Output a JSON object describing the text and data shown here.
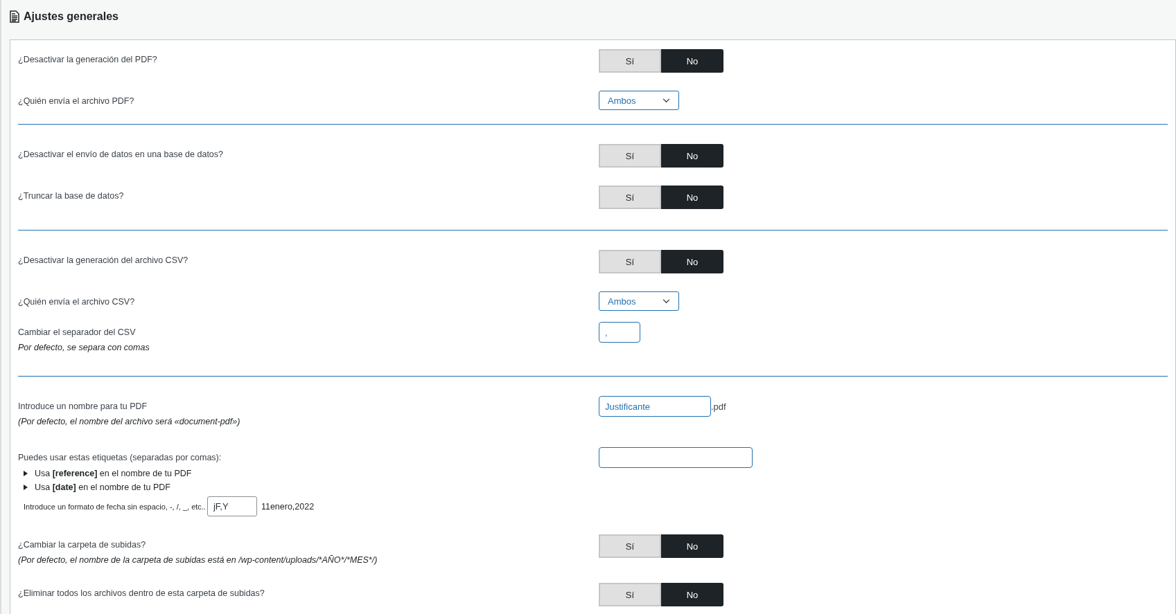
{
  "page": {
    "title": "Ajustes generales"
  },
  "sections": [
    {
      "rows": [
        {
          "kind": "toggle",
          "label": "¿Desactivar la generación del PDF?",
          "options": [
            {
              "label": "Sí",
              "selected": false
            },
            {
              "label": "No",
              "selected": true
            }
          ]
        },
        {
          "kind": "select",
          "label": "¿Quién envía el archivo PDF?",
          "value": "Ambos"
        }
      ]
    },
    {
      "rows": [
        {
          "kind": "toggle",
          "label": "¿Desactivar el envío de datos en una base de datos?",
          "options": [
            {
              "label": "Sí",
              "selected": false
            },
            {
              "label": "No",
              "selected": true
            }
          ]
        },
        {
          "kind": "toggle",
          "label": "¿Truncar la base de datos?",
          "options": [
            {
              "label": "Sí",
              "selected": false
            },
            {
              "label": "No",
              "selected": true
            }
          ]
        }
      ]
    },
    {
      "rows": [
        {
          "kind": "toggle",
          "label": "¿Desactivar la generación del archivo CSV?",
          "options": [
            {
              "label": "Sí",
              "selected": false
            },
            {
              "label": "No",
              "selected": true
            }
          ]
        },
        {
          "kind": "select",
          "label": "¿Quién envía el archivo CSV?",
          "value": "Ambos"
        },
        {
          "kind": "text",
          "label": "Cambiar el separador del CSV",
          "note": "Por defecto, se separa con comas",
          "value": ","
        }
      ]
    },
    {
      "rows": [
        {
          "kind": "text",
          "label": "Introduce un nombre para tu PDF",
          "note": "(Por defecto, el nombre del archivo será «document-pdf»)",
          "value": "Justificante",
          "suffix": ".pdf"
        },
        {
          "kind": "tags",
          "label": "Puedes usar estas etiquetas (separadas por comas):",
          "items": [
            "Usa **[reference]** en el nombre de tu PDF",
            "Usa **[date]** en el nombre de tu PDF"
          ],
          "date_format": {
            "label": "Introduce un formato de fecha sin espacio, -, /, _, etc..",
            "value": "jF,Y",
            "preview": "11enero,2022"
          }
        },
        {
          "kind": "toggle",
          "label": "¿Cambiar la carpeta de subidas?",
          "note": "(Por defecto, el nombre de la carpeta de subidas está en /wp-content/uploads/*AÑO*/*MES*/)",
          "options": [
            {
              "label": "Sí",
              "selected": false
            },
            {
              "label": "No",
              "selected": true
            }
          ]
        },
        {
          "kind": "toggle",
          "label": "¿Eliminar todos los archivos dentro de esta carpeta de subidas?",
          "options": [
            {
              "label": "Sí",
              "selected": false
            },
            {
              "label": "No",
              "selected": true
            }
          ]
        }
      ]
    }
  ]
}
